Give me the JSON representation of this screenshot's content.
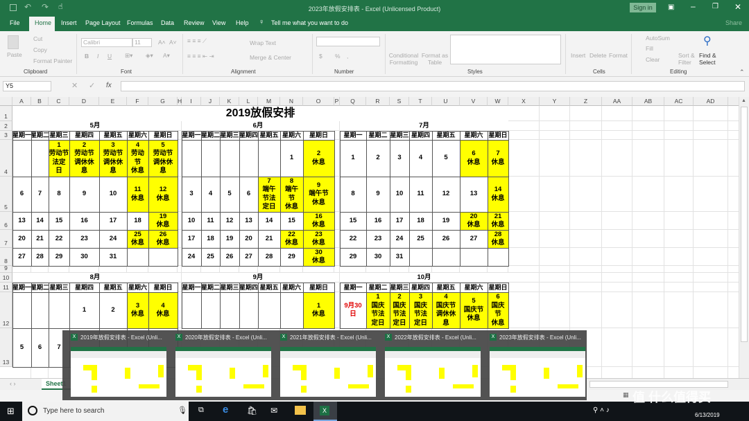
{
  "window": {
    "title": "2023年放假安排表  -  Excel (Unlicensed Product)",
    "sign_in": "Sign in",
    "share": "Share"
  },
  "ribbon_tabs": [
    "File",
    "Home",
    "Insert",
    "Page Layout",
    "Formulas",
    "Data",
    "Review",
    "View",
    "Help"
  ],
  "tell_me": "Tell me what you want to do",
  "ribbon": {
    "clipboard": {
      "label": "Clipboard",
      "paste": "Paste",
      "cut": "Cut",
      "copy": "Copy",
      "format_painter": "Format Painter"
    },
    "font": {
      "label": "Font",
      "name": "Calibri",
      "size": "11",
      "bold": "B",
      "italic": "I",
      "underline": "U"
    },
    "alignment": {
      "label": "Alignment",
      "wrap": "Wrap Text",
      "merge": "Merge & Center"
    },
    "number": {
      "label": "Number",
      "currency": "$",
      "percent": "%",
      "comma": ","
    },
    "styles": {
      "label": "Styles",
      "conditional": "Conditional Formatting",
      "format_table": "Format as Table"
    },
    "cells": {
      "label": "Cells",
      "insert": "Insert",
      "delete": "Delete",
      "format": "Format"
    },
    "editing": {
      "label": "Editing",
      "autosum": "AutoSum",
      "fill": "Fill",
      "clear": "Clear",
      "sort": "Sort & Filter",
      "find": "Find & Select"
    }
  },
  "formula_bar": {
    "name_box": "Y5",
    "fx": "fx",
    "value": ""
  },
  "columns": [
    "A",
    "B",
    "C",
    "D",
    "E",
    "F",
    "G",
    "H",
    "I",
    "J",
    "K",
    "L",
    "M",
    "N",
    "O",
    "P",
    "Q",
    "R",
    "S",
    "T",
    "U",
    "V",
    "W",
    "X",
    "Y",
    "Z",
    "AA",
    "AB",
    "AC",
    "AD"
  ],
  "rows": [
    "1",
    "2",
    "3",
    "4",
    "5",
    "6",
    "7",
    "8",
    "9",
    "10",
    "11",
    "12",
    "13"
  ],
  "sheet": {
    "title": "2019放假安排",
    "weekdays": [
      "星期一",
      "星期二",
      "星期三",
      "星期四",
      "星期五",
      "星期六",
      "星期日"
    ],
    "colors": {
      "holiday": "#ffff00",
      "special": "#e00000"
    },
    "months": [
      {
        "name": "5月",
        "start_col": "A",
        "header_row": 2,
        "first_row": 4,
        "weeks": [
          [
            {
              "t": ""
            },
            {
              "t": ""
            },
            {
              "t": "1\n劳动节\n法定\n日",
              "h": true
            },
            {
              "t": "2\n劳动节\n调休休\n息",
              "h": true
            },
            {
              "t": "3\n劳动节\n调休休\n息",
              "h": true
            },
            {
              "t": "4\n劳动\n节\n休息",
              "h": true
            },
            {
              "t": "5\n劳动节\n调休休\n息",
              "h": true
            }
          ],
          [
            {
              "t": "6"
            },
            {
              "t": "7"
            },
            {
              "t": "8"
            },
            {
              "t": "9"
            },
            {
              "t": "10"
            },
            {
              "t": "11\n休息",
              "h": true
            },
            {
              "t": "12\n休息",
              "h": true
            }
          ],
          [
            {
              "t": "13"
            },
            {
              "t": "14"
            },
            {
              "t": "15"
            },
            {
              "t": "16"
            },
            {
              "t": "17"
            },
            {
              "t": "18"
            },
            {
              "t": "19\n休息",
              "h": true
            }
          ],
          [
            {
              "t": "20"
            },
            {
              "t": "21"
            },
            {
              "t": "22"
            },
            {
              "t": "23"
            },
            {
              "t": "24"
            },
            {
              "t": "25\n休息",
              "h": true
            },
            {
              "t": "26\n休息",
              "h": true
            }
          ],
          [
            {
              "t": "27"
            },
            {
              "t": "28"
            },
            {
              "t": "29"
            },
            {
              "t": "30"
            },
            {
              "t": "31"
            },
            {
              "t": ""
            },
            {
              "t": ""
            }
          ]
        ]
      },
      {
        "name": "6月",
        "start_col": "I",
        "header_row": 2,
        "first_row": 4,
        "weeks": [
          [
            {
              "t": ""
            },
            {
              "t": ""
            },
            {
              "t": ""
            },
            {
              "t": ""
            },
            {
              "t": ""
            },
            {
              "t": "1"
            },
            {
              "t": "2\n休息",
              "h": true
            }
          ],
          [
            {
              "t": "3"
            },
            {
              "t": "4"
            },
            {
              "t": "5"
            },
            {
              "t": "6"
            },
            {
              "t": "7\n端午\n节法\n定日",
              "h": true
            },
            {
              "t": "8\n端午\n节\n休息",
              "h": true
            },
            {
              "t": "9\n端午节\n休息",
              "h": true
            }
          ],
          [
            {
              "t": "10"
            },
            {
              "t": "11"
            },
            {
              "t": "12"
            },
            {
              "t": "13"
            },
            {
              "t": "14"
            },
            {
              "t": "15"
            },
            {
              "t": "16\n休息",
              "h": true
            }
          ],
          [
            {
              "t": "17"
            },
            {
              "t": "18"
            },
            {
              "t": "19"
            },
            {
              "t": "20"
            },
            {
              "t": "21"
            },
            {
              "t": "22\n休息",
              "h": true
            },
            {
              "t": "23\n休息",
              "h": true
            }
          ],
          [
            {
              "t": "24"
            },
            {
              "t": "25"
            },
            {
              "t": "26"
            },
            {
              "t": "27"
            },
            {
              "t": "28"
            },
            {
              "t": "29"
            },
            {
              "t": "30\n休息",
              "h": true
            }
          ]
        ]
      },
      {
        "name": "7月",
        "start_col": "Q",
        "header_row": 2,
        "first_row": 4,
        "weeks": [
          [
            {
              "t": "1"
            },
            {
              "t": "2"
            },
            {
              "t": "3"
            },
            {
              "t": "4"
            },
            {
              "t": "5"
            },
            {
              "t": "6\n休息",
              "h": true
            },
            {
              "t": "7\n休息",
              "h": true
            }
          ],
          [
            {
              "t": "8"
            },
            {
              "t": "9"
            },
            {
              "t": "10"
            },
            {
              "t": "11"
            },
            {
              "t": "12"
            },
            {
              "t": "13"
            },
            {
              "t": "14\n休息",
              "h": true
            }
          ],
          [
            {
              "t": "15"
            },
            {
              "t": "16"
            },
            {
              "t": "17"
            },
            {
              "t": "18"
            },
            {
              "t": "19"
            },
            {
              "t": "20\n休息",
              "h": true
            },
            {
              "t": "21\n休息",
              "h": true
            }
          ],
          [
            {
              "t": "22"
            },
            {
              "t": "23"
            },
            {
              "t": "24"
            },
            {
              "t": "25"
            },
            {
              "t": "26"
            },
            {
              "t": "27"
            },
            {
              "t": "28\n休息",
              "h": true
            }
          ],
          [
            {
              "t": "29"
            },
            {
              "t": "30"
            },
            {
              "t": "31"
            },
            {
              "t": ""
            },
            {
              "t": ""
            },
            {
              "t": ""
            },
            {
              "t": ""
            }
          ]
        ]
      },
      {
        "name": "8月",
        "start_col": "A",
        "header_row": 10,
        "first_row": 12,
        "weeks": [
          [
            {
              "t": ""
            },
            {
              "t": ""
            },
            {
              "t": ""
            },
            {
              "t": "1"
            },
            {
              "t": "2"
            },
            {
              "t": "3\n休息",
              "h": true
            },
            {
              "t": "4\n休息",
              "h": true
            }
          ],
          [
            {
              "t": "5"
            },
            {
              "t": "6"
            },
            {
              "t": "7"
            },
            {
              "t": ""
            },
            {
              "t": ""
            },
            {
              "t": ""
            },
            {
              "t": ""
            }
          ]
        ]
      },
      {
        "name": "9月",
        "start_col": "I",
        "header_row": 10,
        "first_row": 12,
        "weeks": [
          [
            {
              "t": ""
            },
            {
              "t": ""
            },
            {
              "t": ""
            },
            {
              "t": ""
            },
            {
              "t": ""
            },
            {
              "t": ""
            },
            {
              "t": "1\n休息",
              "h": true
            }
          ]
        ]
      },
      {
        "name": "10月",
        "start_col": "Q",
        "header_row": 10,
        "first_row": 12,
        "weeks": [
          [
            {
              "t": "9月30\n日",
              "r": true
            },
            {
              "t": "1\n国庆\n节法\n定日",
              "h": true
            },
            {
              "t": "2\n国庆\n节法\n定日",
              "h": true
            },
            {
              "t": "3\n国庆\n节法\n定日",
              "h": true
            },
            {
              "t": "4\n国庆节\n调休休\n息",
              "h": true
            },
            {
              "t": "5\n国庆节\n休息",
              "h": true
            },
            {
              "t": "6\n国庆\n节\n休息",
              "h": true
            }
          ]
        ]
      }
    ]
  },
  "sheet_tab": "Sheet1",
  "thumbnails": [
    "2019年放假安排表 - Excel (Unli...",
    "2020年放假安排表 - Excel (Unli...",
    "2021年放假安排表 - Excel (Unli...",
    "2022年放假安排表 - Excel (Unli...",
    "2023年放假安排表 - Excel (Unli..."
  ],
  "taskbar": {
    "search_placeholder": "Type here to search",
    "date": "6/13/2019",
    "watermark": "值 什么值得买"
  }
}
